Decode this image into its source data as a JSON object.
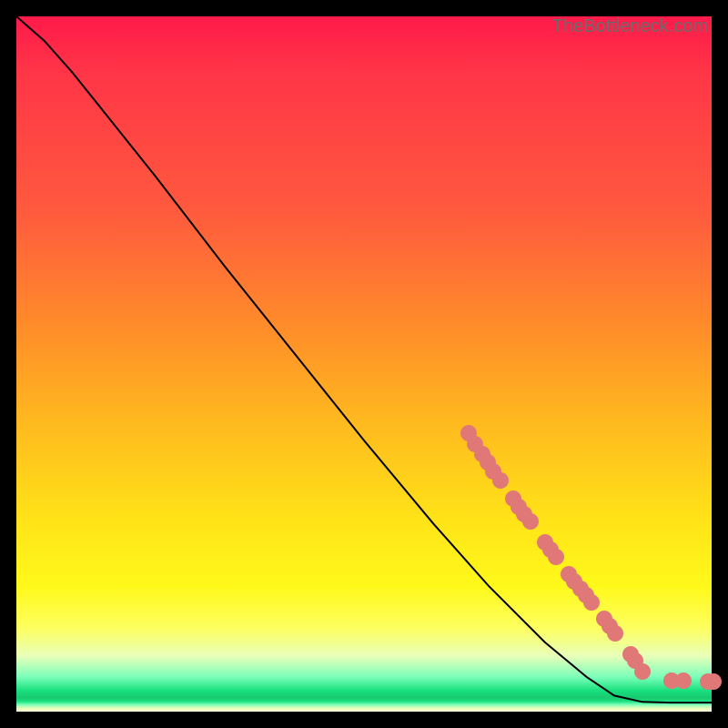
{
  "watermark": "TheBottleneck.com",
  "colors": {
    "marker": "#e17878",
    "curve": "#000000"
  },
  "chart_data": {
    "type": "line",
    "title": "",
    "xlabel": "",
    "ylabel": "",
    "xlim": [
      0,
      100
    ],
    "ylim": [
      0,
      100
    ],
    "curve": [
      {
        "x": 0,
        "y": 100
      },
      {
        "x": 4,
        "y": 96.5
      },
      {
        "x": 8,
        "y": 92
      },
      {
        "x": 12,
        "y": 87
      },
      {
        "x": 20,
        "y": 77
      },
      {
        "x": 30,
        "y": 64
      },
      {
        "x": 40,
        "y": 51.5
      },
      {
        "x": 50,
        "y": 39
      },
      {
        "x": 60,
        "y": 27
      },
      {
        "x": 68,
        "y": 18
      },
      {
        "x": 76,
        "y": 10
      },
      {
        "x": 82,
        "y": 5
      },
      {
        "x": 86,
        "y": 2.3
      },
      {
        "x": 90,
        "y": 1.4
      },
      {
        "x": 94,
        "y": 1.3
      },
      {
        "x": 98,
        "y": 1.3
      },
      {
        "x": 100,
        "y": 1.3
      }
    ],
    "markers": [
      {
        "x": 65,
        "y": 40
      },
      {
        "x": 66,
        "y": 38.5
      },
      {
        "x": 67,
        "y": 37
      },
      {
        "x": 67.8,
        "y": 35.8
      },
      {
        "x": 68.6,
        "y": 34.6
      },
      {
        "x": 69.6,
        "y": 33.2
      },
      {
        "x": 71.5,
        "y": 30.6
      },
      {
        "x": 72.3,
        "y": 29.5
      },
      {
        "x": 73.1,
        "y": 28.4
      },
      {
        "x": 73.9,
        "y": 27.3
      },
      {
        "x": 76.0,
        "y": 24.4
      },
      {
        "x": 76.8,
        "y": 23.3
      },
      {
        "x": 77.6,
        "y": 22.2
      },
      {
        "x": 79.5,
        "y": 19.7
      },
      {
        "x": 80.3,
        "y": 18.7
      },
      {
        "x": 81.1,
        "y": 17.7
      },
      {
        "x": 81.9,
        "y": 16.7
      },
      {
        "x": 82.7,
        "y": 15.7
      },
      {
        "x": 84.5,
        "y": 13.3
      },
      {
        "x": 85.3,
        "y": 12.3
      },
      {
        "x": 86.1,
        "y": 11.3
      },
      {
        "x": 88.3,
        "y": 8.3
      },
      {
        "x": 89.0,
        "y": 7.3
      },
      {
        "x": 90.0,
        "y": 5.8
      },
      {
        "x": 94.2,
        "y": 4.5
      },
      {
        "x": 96.0,
        "y": 4.4
      },
      {
        "x": 99.5,
        "y": 4.3
      },
      {
        "x": 100.2,
        "y": 4.3
      }
    ]
  }
}
